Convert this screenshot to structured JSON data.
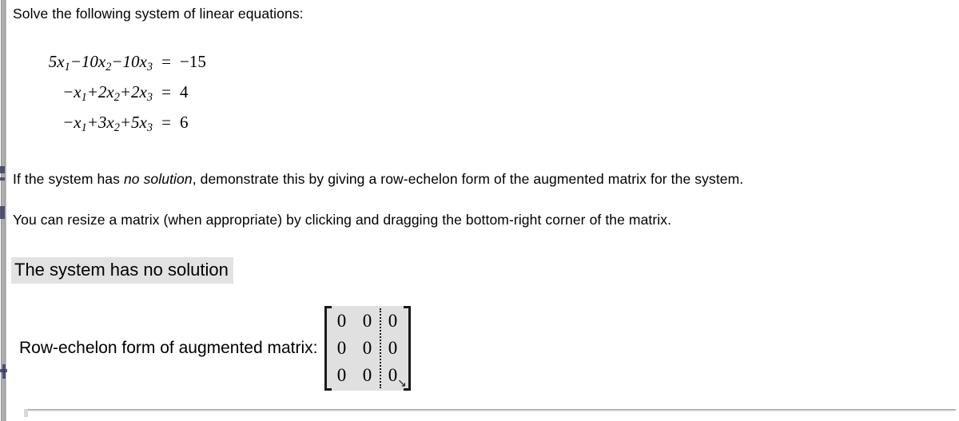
{
  "prompt": {
    "intro": "Solve the following system of linear equations:",
    "instruction_prefix": "If the system has ",
    "instruction_emphasis": "no solution",
    "instruction_suffix": ", demonstrate this by giving a row-echelon form of the augmented matrix for the system.",
    "resize_hint": "You can resize a matrix (when appropriate) by clicking and dragging the bottom-right corner of the matrix."
  },
  "equations": [
    {
      "lhs_html": "5x<sub>1</sub>−10x<sub>2</sub>−10x<sub>3</sub>",
      "eq": "=",
      "rhs": "−15"
    },
    {
      "lhs_html": "−x<sub>1</sub>+2x<sub>2</sub>+2x<sub>3</sub>",
      "eq": "=",
      "rhs": "4"
    },
    {
      "lhs_html": "−x<sub>1</sub>+3x<sub>2</sub>+5x<sub>3</sub>",
      "eq": "=",
      "rhs": "6"
    }
  ],
  "answer": {
    "statement": "The system has no solution",
    "statement_highlight_color": "#e2e2e2",
    "matrix_label": "Row-echelon form of augmented matrix:"
  },
  "matrix": {
    "rows": 3,
    "cols": 3,
    "augmented_divider_after_col": 2,
    "background_color": "#e0e0e0",
    "bracket_color": "#1a1a1a",
    "values": [
      [
        "0",
        "0",
        "0"
      ],
      [
        "0",
        "0",
        "0"
      ],
      [
        "0",
        "0",
        "0"
      ]
    ],
    "resize_handle_icon": "↘"
  },
  "chrome": {
    "scrollbar_name": "vertical-scrollbar",
    "scrollbar_color": "#a8a8a8"
  }
}
